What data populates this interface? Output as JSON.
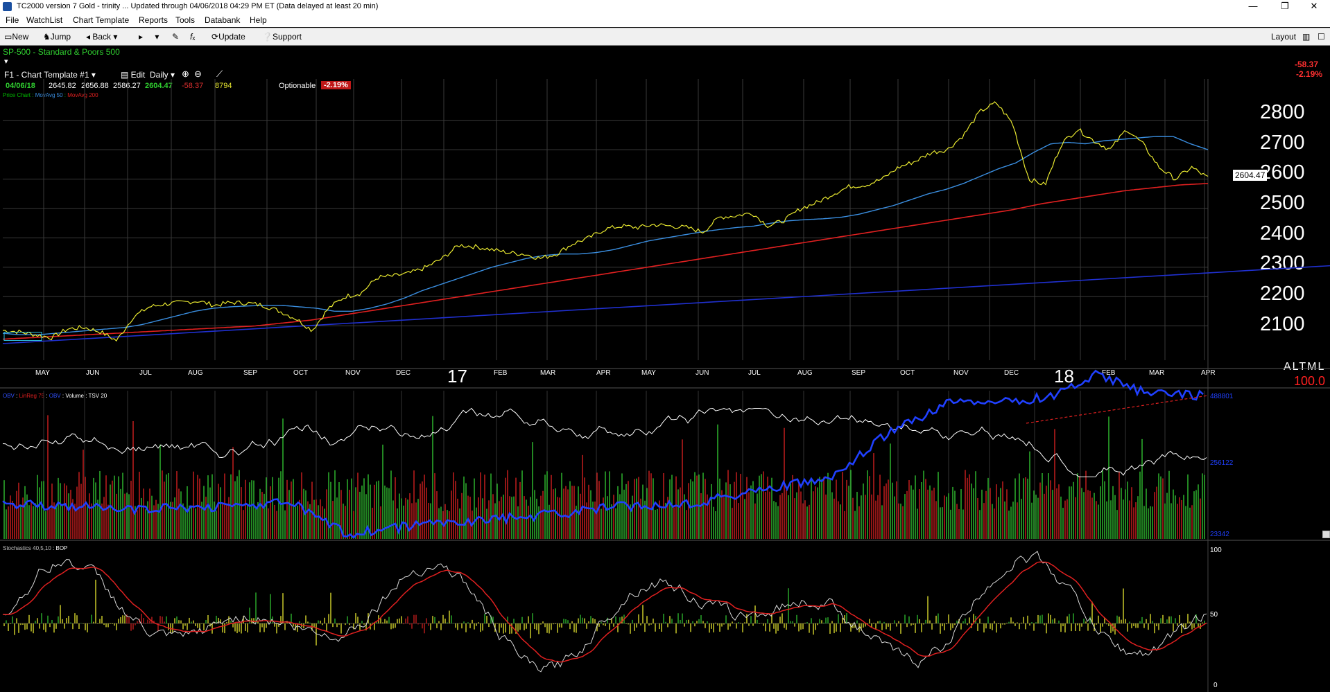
{
  "window": {
    "title": "TC2000 version 7 Gold - trinity  ... Updated through 04/06/2018  04:29 PM ET  (Data delayed at least 20 min)",
    "controls": [
      "—",
      "❐",
      "✕"
    ]
  },
  "menu": [
    "File",
    "WatchList",
    "Chart Template",
    "Reports",
    "Tools",
    "Databank",
    "Help"
  ],
  "toolbar": {
    "new_label": "New",
    "jump_label": "Jump",
    "back_label": "Back",
    "update_label": "Update",
    "support_label": "Support",
    "layout_label": "Layout"
  },
  "chart_header": {
    "symbol": "SP-500 - Standard & Poors 500",
    "template": "F1 - Chart Template #1",
    "edit_label": "Edit",
    "period": "Daily",
    "date": "04/06/18",
    "open": "2645.82",
    "high": "2656.88",
    "low": "2586.27",
    "close": "2604.47",
    "change": "-58.37",
    "volume": "8794",
    "optionable_label": "Optionable",
    "pct_change": "-2.19%",
    "right_change": "-58.37",
    "right_pct": "-2.19%",
    "indicators": [
      {
        "text": "Price Chart",
        "color": "#00c000"
      },
      {
        "text": " : ",
        "color": "#00c000"
      },
      {
        "text": "MovAvg 50",
        "color": "#3a8ee0"
      },
      {
        "text": " : ",
        "color": "#00c000"
      },
      {
        "text": "MovAvg 200",
        "color": "#e02020"
      }
    ]
  },
  "price_axis": {
    "labels": [
      "2800",
      "2700",
      "2600",
      "2500",
      "2400",
      "2300",
      "2200",
      "2100"
    ],
    "last_price_tag": "2604.47",
    "scale_btns": "ALTML",
    "zoom": "100.0"
  },
  "time_axis": {
    "months": [
      "MAY",
      "JUN",
      "JUL",
      "AUG",
      "SEP",
      "OCT",
      "NOV",
      "DEC",
      "FEB",
      "MAR",
      "APR",
      "MAY",
      "JUN",
      "JUL",
      "AUG",
      "SEP",
      "OCT",
      "NOV",
      "DEC",
      "FEB",
      "MAR",
      "APR"
    ],
    "years": [
      "17",
      "18"
    ]
  },
  "volume_panel": {
    "legend": [
      {
        "text": "OBV",
        "color": "#3050ff"
      },
      {
        "text": " : ",
        "color": "#ffffff"
      },
      {
        "text": "LinReg 75",
        "color": "#e02020"
      },
      {
        "text": " : ",
        "color": "#ffffff"
      },
      {
        "text": "OBV",
        "color": "#3050ff"
      },
      {
        "text": " : ",
        "color": "#ffffff"
      },
      {
        "text": "Volume",
        "color": "#ffffff"
      },
      {
        "text": " : ",
        "color": "#ffffff"
      },
      {
        "text": "TSV 20",
        "color": "#ffffff"
      }
    ],
    "scale": [
      "488801",
      "256122",
      "23342"
    ]
  },
  "stoch_panel": {
    "legend": [
      {
        "text": "Stochastics 40,5,10",
        "color": "#c0c0c0"
      },
      {
        "text": " : ",
        "color": "#ffffff"
      },
      {
        "text": "BOP",
        "color": "#ffffff"
      }
    ],
    "scale": [
      "100",
      "50",
      "0"
    ]
  },
  "colors": {
    "price": "#e8e830",
    "ma50": "#3a8ee0",
    "ma200": "#e02020",
    "trend": "#2030d0",
    "obv": "#2040ff",
    "up": "#30c030",
    "down": "#d02020"
  },
  "chart_data": {
    "type": "line",
    "series": [
      {
        "name": "Price Chart",
        "values": [
          2085,
          2080,
          2070,
          2060,
          2090,
          2095,
          2080,
          2050,
          2130,
          2165,
          2175,
          2180,
          2185,
          2170,
          2180,
          2178,
          2170,
          2150,
          2125,
          2085,
          2160,
          2200,
          2212,
          2265,
          2270,
          2280,
          2300,
          2330,
          2375,
          2370,
          2360,
          2350,
          2345,
          2330,
          2345,
          2380,
          2400,
          2430,
          2440,
          2435,
          2445,
          2440,
          2435,
          2420,
          2470,
          2475,
          2485,
          2440,
          2460,
          2500,
          2520,
          2550,
          2575,
          2580,
          2600,
          2640,
          2660,
          2690,
          2700,
          2750,
          2830,
          2860,
          2790,
          2600,
          2580,
          2720,
          2770,
          2730,
          2700,
          2770,
          2720,
          2640,
          2600,
          2640,
          2604
        ]
      },
      {
        "name": "MovAvg 50",
        "values": [
          2075,
          2070,
          2070,
          2075,
          2080,
          2085,
          2090,
          2095,
          2105,
          2120,
          2135,
          2150,
          2160,
          2165,
          2168,
          2170,
          2170,
          2165,
          2160,
          2150,
          2150,
          2160,
          2175,
          2195,
          2220,
          2240,
          2260,
          2280,
          2300,
          2315,
          2330,
          2340,
          2345,
          2345,
          2350,
          2360,
          2375,
          2390,
          2400,
          2410,
          2420,
          2428,
          2435,
          2440,
          2450,
          2458,
          2462,
          2465,
          2470,
          2480,
          2495,
          2510,
          2530,
          2550,
          2565,
          2585,
          2610,
          2635,
          2655,
          2690,
          2720,
          2725,
          2720,
          2730,
          2735,
          2740,
          2745,
          2745,
          2720,
          2700
        ]
      },
      {
        "name": "MovAvg 200",
        "values": [
          2055,
          2060,
          2065,
          2070,
          2075,
          2080,
          2085,
          2090,
          2095,
          2100,
          2110,
          2120,
          2135,
          2150,
          2165,
          2180,
          2195,
          2210,
          2225,
          2240,
          2255,
          2270,
          2285,
          2300,
          2315,
          2330,
          2345,
          2360,
          2375,
          2390,
          2405,
          2420,
          2435,
          2450,
          2465,
          2480,
          2495,
          2515,
          2530,
          2545,
          2560,
          2570,
          2580,
          2585
        ]
      }
    ],
    "ylim": [
      2040,
      2870
    ],
    "stoch_ylim": [
      0,
      100
    ],
    "grid": true
  }
}
